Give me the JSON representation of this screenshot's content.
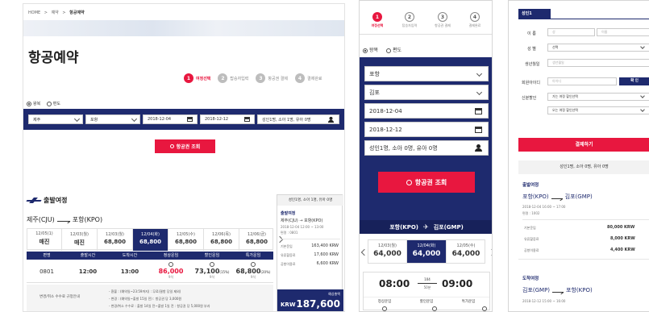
{
  "panel1": {
    "breadcrumb": [
      "HOME",
      "예약",
      "항공예약"
    ],
    "page_title": "항공예약",
    "steps": [
      {
        "num": "1",
        "label": "여정선택",
        "active": true
      },
      {
        "num": "2",
        "label": "탑승자입력",
        "active": false
      },
      {
        "num": "3",
        "label": "항공권 결제",
        "active": false
      },
      {
        "num": "4",
        "label": "결제완료",
        "active": false
      }
    ],
    "trip_types": [
      "왕복",
      "편도"
    ],
    "search": {
      "from": "제주",
      "to": "포항",
      "date_start": "2018-12-04",
      "date_end": "2018-12-12",
      "passengers": "성인1명, 소아 1명, 유아 0명"
    },
    "search_button": "항공권 조회",
    "section_title": "출발여정",
    "route": {
      "from": "제주(CJU)",
      "to": "포항(KPO)"
    },
    "dates": [
      {
        "date": "12/05(1)",
        "price": "매진"
      },
      {
        "date": "12/03(월)",
        "price": "매진"
      },
      {
        "date": "12/03(월)",
        "price": "68,800"
      },
      {
        "date": "12/04(화)",
        "price": "68,800",
        "selected": true
      },
      {
        "date": "12/05(수)",
        "price": "68,800"
      },
      {
        "date": "12/06(목)",
        "price": "68,800"
      },
      {
        "date": "12/06(금)",
        "price": "68,800"
      }
    ],
    "table_headers": [
      "편명",
      "출발시간",
      "도착시간",
      "정상운임",
      "할인운임",
      "특가운임"
    ],
    "flight": {
      "no": "0801",
      "dep": "12:00",
      "arr": "13:00",
      "fare_normal": "86,000",
      "fare_normal_note": "9석",
      "fare_discount": "73,100",
      "fare_discount_pct": "(15%)",
      "fare_discount_note": "9석",
      "fare_special": "68,800",
      "fare_special_pct": "(20%)",
      "fare_special_note": "9석"
    },
    "notice_label": "변경/취소 수수료 규정안내",
    "notice_lines": [
      "- 환불 : (예약일~23:59까지) : 무료(결항 당일 제외)",
      "- 변경 : (예약일~출발 15일 전) : 항공권 당 3,000원",
      "- 변경/취소 수수료 : 출발 14일 전~출발 1일 전 : 항공권 당 5,000원 부과"
    ],
    "summary": {
      "passengers": "성인1명, 소아 1명, 유아 0명",
      "leg_title": "출발여정",
      "leg_route": "제주(CJU) → 포항(KPO)",
      "leg_time": "2018-12-04 12:00 ~ 13:00",
      "leg_flight": "편명 : 0801",
      "rows": [
        {
          "label": "기본운임",
          "value": "163,400 KRW"
        },
        {
          "label": "유류할증료",
          "value": "17,600 KRW"
        },
        {
          "label": "공항이용료",
          "value": "6,600 KRW"
        }
      ],
      "total_label": "예상총액",
      "currency": "KRW",
      "total": "187,600"
    }
  },
  "panel2": {
    "steps": [
      {
        "num": "1",
        "label": "여정선택",
        "active": true
      },
      {
        "num": "2",
        "label": "탑승자입력",
        "active": false
      },
      {
        "num": "3",
        "label": "항공권 결제",
        "active": false
      },
      {
        "num": "4",
        "label": "결제완료",
        "active": false
      }
    ],
    "trip_types": [
      "왕복",
      "편도"
    ],
    "from": "포항",
    "to": "김포",
    "date_start": "2018-12-04",
    "date_end": "2018-12-12",
    "passengers": "성인1명, 소아 0명, 유아 0명",
    "search_button": "항공권 조회",
    "route_bar": {
      "from": "포항(KPO)",
      "to": "김포(GMP)"
    },
    "dates": [
      {
        "date": "12/03(월)",
        "price": "64,000"
      },
      {
        "date": "12/04(화)",
        "price": "64,000",
        "selected": true
      },
      {
        "date": "12/05(수)",
        "price": "64,000"
      }
    ],
    "dep_time": "08:00",
    "arr_time": "09:00",
    "flight_no": "104",
    "flight_type": "50분",
    "fare_headers": [
      "정상운임",
      "할인운임",
      "특가운임"
    ]
  },
  "panel3": {
    "form_tab": "성인1",
    "labels": {
      "name": "이 름",
      "gender": "성 별",
      "birth": "생년월일",
      "member": "회원아이디",
      "discount": "신분할인"
    },
    "placeholders": {
      "surname": "성",
      "given": "이름",
      "birth": "생년월일",
      "member": "아이디"
    },
    "gender_value": "선택",
    "confirm_button": "확 인",
    "discount_1": "가는 여정 할인선택",
    "discount_2": "오는 여정 할인선택",
    "pay_button": "결제하기",
    "passengers": "성인1명, 소아 0명, 유아 0명",
    "leg1": {
      "title": "출발여정",
      "from": "포항(KPO)",
      "to": "김포(GMP)",
      "time": "2018-12-04 16:00 ~ 17:00",
      "flight": "편명 : 1002",
      "rows": [
        {
          "label": "기본운임",
          "value": "80,000 KRW"
        },
        {
          "label": "유류할증료",
          "value": "8,000 KRW"
        },
        {
          "label": "공항이용료",
          "value": "4,400 KRW"
        }
      ]
    },
    "leg2": {
      "title": "도착여정",
      "from": "김포(GMP)",
      "to": "포항(KPO)",
      "time": "2018-12-12 15:00 ~ 16:00"
    }
  }
}
